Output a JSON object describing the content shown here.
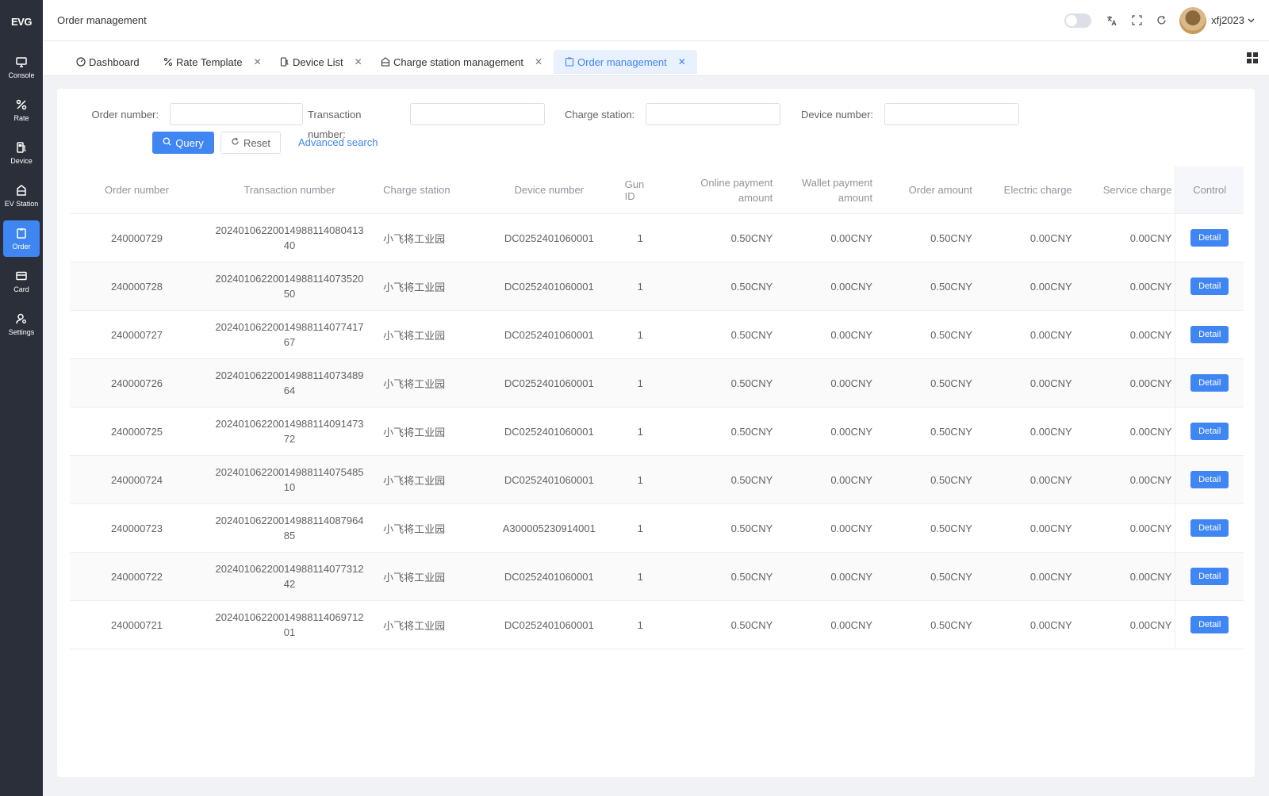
{
  "app": {
    "logo": "EVG"
  },
  "sidebar": {
    "items": [
      {
        "label": "Console",
        "icon": "monitor-icon"
      },
      {
        "label": "Rate",
        "icon": "percent-icon"
      },
      {
        "label": "Device",
        "icon": "charger-icon"
      },
      {
        "label": "EV Station",
        "icon": "station-icon"
      },
      {
        "label": "Order",
        "icon": "clipboard-icon",
        "active": true
      },
      {
        "label": "Card",
        "icon": "card-icon"
      },
      {
        "label": "Settings",
        "icon": "user-settings-icon"
      }
    ]
  },
  "header": {
    "breadcrumb": "Order management",
    "username": "xfj2023"
  },
  "tabs": [
    {
      "label": "Dashboard",
      "icon": "dashboard-icon",
      "closable": false
    },
    {
      "label": "Rate Template",
      "icon": "percent-icon",
      "closable": true
    },
    {
      "label": "Device List",
      "icon": "charger-icon",
      "closable": true
    },
    {
      "label": "Charge station management",
      "icon": "station-icon",
      "closable": true
    },
    {
      "label": "Order management",
      "icon": "clipboard-icon",
      "closable": true,
      "active": true
    }
  ],
  "filters": {
    "order_number_label": "Order number:",
    "order_number_value": "",
    "transaction_label_1": "Transaction",
    "transaction_label_2": "number:",
    "transaction_value": "",
    "charge_station_label": "Charge station:",
    "charge_station_value": "",
    "device_number_label": "Device number:",
    "device_number_value": "",
    "query_label": "Query",
    "reset_label": "Reset",
    "advanced_label": "Advanced search"
  },
  "table": {
    "columns": {
      "order": "Order number",
      "trans": "Transaction number",
      "station": "Charge station",
      "device": "Device number",
      "gun": "Gun ID",
      "online": "Online payment amount",
      "wallet": "Wallet payment amount",
      "amount": "Order amount",
      "elec": "Electric charge",
      "serv": "Service charge",
      "ctrl": "Control"
    },
    "detail_label": "Detail",
    "rows": [
      {
        "order": "240000729",
        "trans": "20240106220014988114080413 40",
        "station": "小飞将工业园",
        "device": "DC0252401060001",
        "gun": "1",
        "online": "0.50CNY",
        "wallet": "0.00CNY",
        "amount": "0.50CNY",
        "elec": "0.00CNY",
        "serv": "0.00CNY"
      },
      {
        "order": "240000728",
        "trans": "20240106220014988114073520 50",
        "station": "小飞将工业园",
        "device": "DC0252401060001",
        "gun": "1",
        "online": "0.50CNY",
        "wallet": "0.00CNY",
        "amount": "0.50CNY",
        "elec": "0.00CNY",
        "serv": "0.00CNY"
      },
      {
        "order": "240000727",
        "trans": "20240106220014988114077417 67",
        "station": "小飞将工业园",
        "device": "DC0252401060001",
        "gun": "1",
        "online": "0.50CNY",
        "wallet": "0.00CNY",
        "amount": "0.50CNY",
        "elec": "0.00CNY",
        "serv": "0.00CNY"
      },
      {
        "order": "240000726",
        "trans": "20240106220014988114073489 64",
        "station": "小飞将工业园",
        "device": "DC0252401060001",
        "gun": "1",
        "online": "0.50CNY",
        "wallet": "0.00CNY",
        "amount": "0.50CNY",
        "elec": "0.00CNY",
        "serv": "0.00CNY"
      },
      {
        "order": "240000725",
        "trans": "20240106220014988114091473 72",
        "station": "小飞将工业园",
        "device": "DC0252401060001",
        "gun": "1",
        "online": "0.50CNY",
        "wallet": "0.00CNY",
        "amount": "0.50CNY",
        "elec": "0.00CNY",
        "serv": "0.00CNY"
      },
      {
        "order": "240000724",
        "trans": "20240106220014988114075485 10",
        "station": "小飞将工业园",
        "device": "DC0252401060001",
        "gun": "1",
        "online": "0.50CNY",
        "wallet": "0.00CNY",
        "amount": "0.50CNY",
        "elec": "0.00CNY",
        "serv": "0.00CNY"
      },
      {
        "order": "240000723",
        "trans": "20240106220014988114087964 85",
        "station": "小飞将工业园",
        "device": "A300005230914001",
        "gun": "1",
        "online": "0.50CNY",
        "wallet": "0.00CNY",
        "amount": "0.50CNY",
        "elec": "0.00CNY",
        "serv": "0.00CNY"
      },
      {
        "order": "240000722",
        "trans": "20240106220014988114077312 42",
        "station": "小飞将工业园",
        "device": "DC0252401060001",
        "gun": "1",
        "online": "0.50CNY",
        "wallet": "0.00CNY",
        "amount": "0.50CNY",
        "elec": "0.00CNY",
        "serv": "0.00CNY"
      },
      {
        "order": "240000721",
        "trans": "20240106220014988114069712 01",
        "station": "小飞将工业园",
        "device": "DC0252401060001",
        "gun": "1",
        "online": "0.50CNY",
        "wallet": "0.00CNY",
        "amount": "0.50CNY",
        "elec": "0.00CNY",
        "serv": "0.00CNY"
      }
    ]
  }
}
